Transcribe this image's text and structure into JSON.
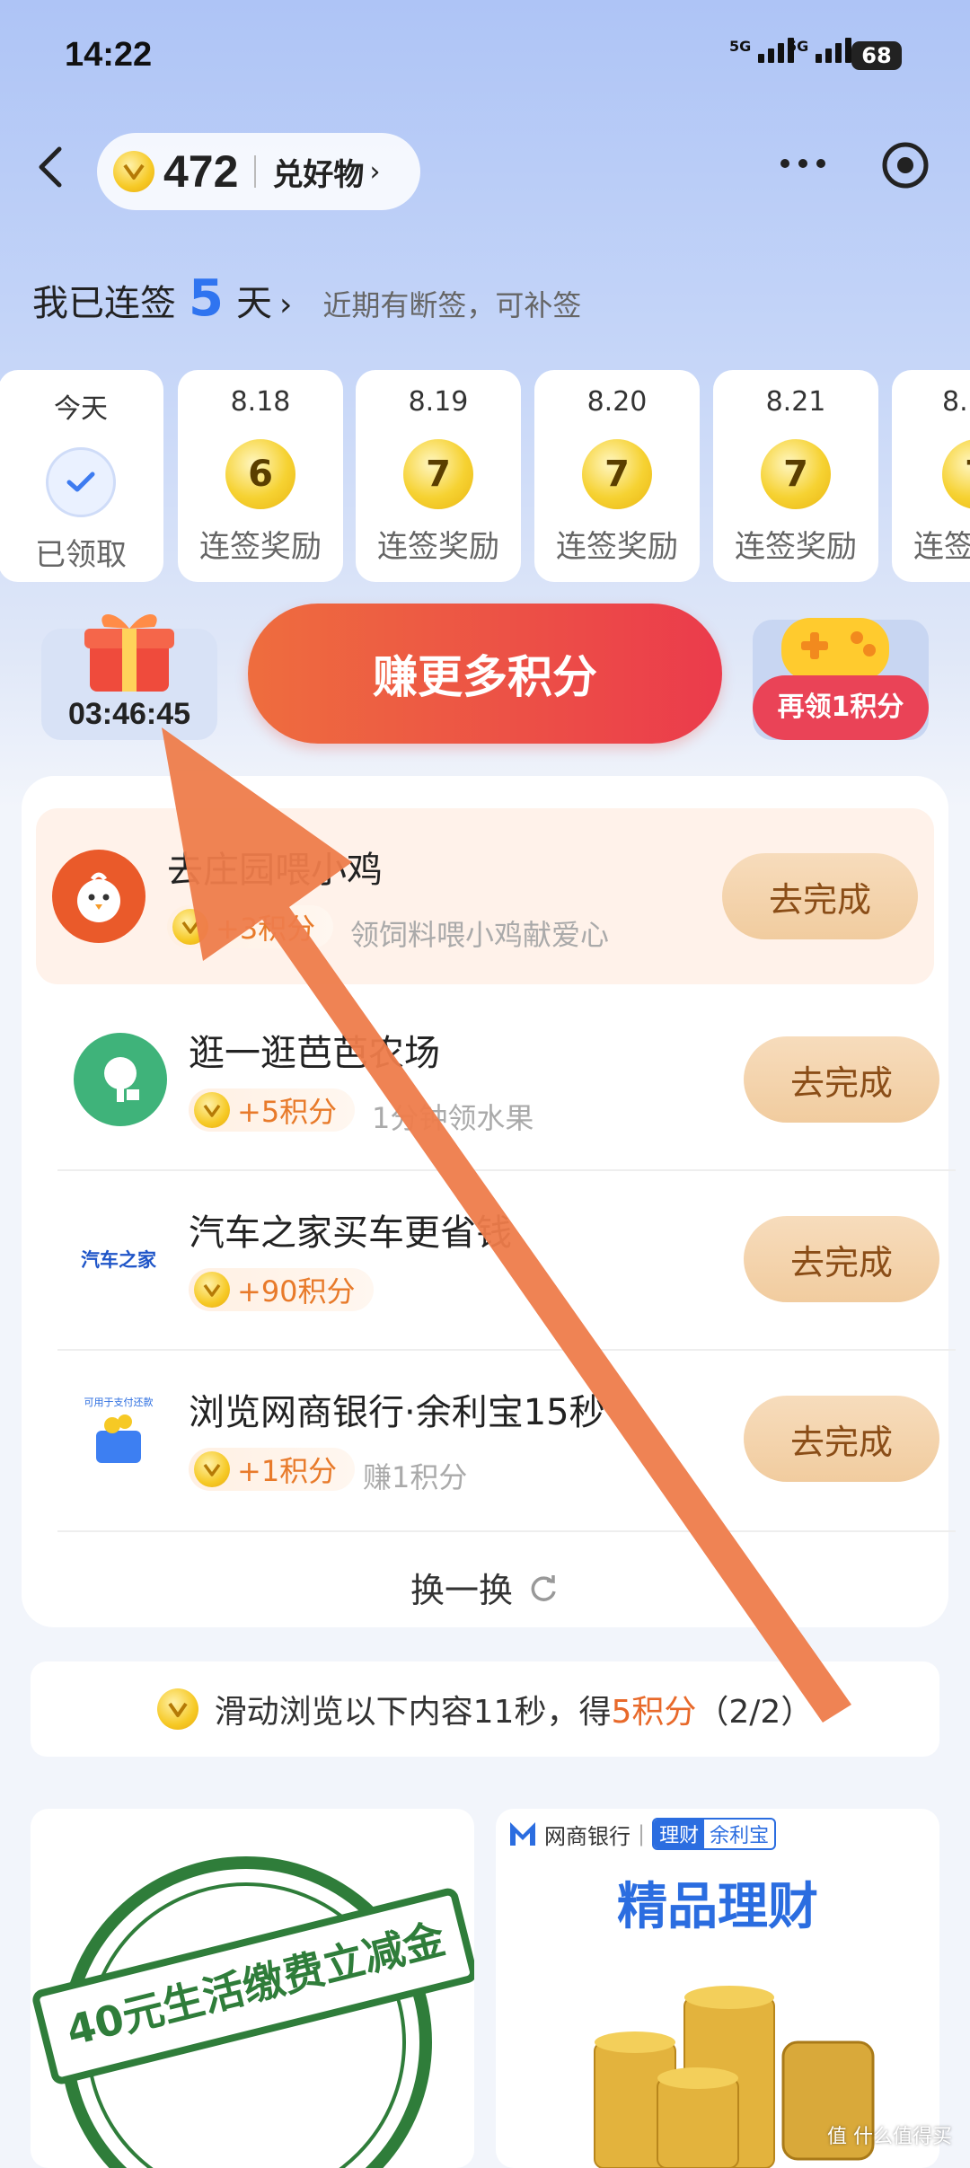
{
  "status_bar": {
    "time": "14:22",
    "network1": "5G",
    "network2": "5G",
    "battery": "68"
  },
  "header": {
    "points": "472",
    "exchange_link": "兑好物",
    "more_icon": "more-icon",
    "target_icon": "target-icon"
  },
  "streak": {
    "prefix": "我已连签",
    "days": "5",
    "suffix": "天",
    "chevron": "›",
    "note": "近期有断签，可补签"
  },
  "day_cards": [
    {
      "date": "今天",
      "badge": "",
      "label": "已领取"
    },
    {
      "date": "8.18",
      "badge": "6",
      "label": "连签奖励"
    },
    {
      "date": "8.19",
      "badge": "7",
      "label": "连签奖励"
    },
    {
      "date": "8.20",
      "badge": "7",
      "label": "连签奖励"
    },
    {
      "date": "8.21",
      "badge": "7",
      "label": "连签奖励"
    },
    {
      "date": "8.",
      "badge": "7",
      "label": "连签"
    }
  ],
  "actions": {
    "gift_timer": "03:46:45",
    "earn_more": "赚更多积分",
    "claim_again": "再领1积分"
  },
  "tasks": [
    {
      "title": "去庄园喂小鸡",
      "reward": "+3积分",
      "desc": "领饲料喂小鸡献爱心",
      "button": "去完成"
    },
    {
      "title": "逛一逛芭芭农场",
      "reward": "+5积分",
      "desc": "1分钟领水果",
      "button": "去完成"
    },
    {
      "title": "汽车之家买车更省钱",
      "reward": "+90积分",
      "desc": "",
      "button": "去完成"
    },
    {
      "title": "浏览网商银行·余利宝15秒",
      "reward": "+1积分",
      "desc": "赚1积分",
      "button": "去完成"
    }
  ],
  "task_icons": {
    "car_logo_text": "汽车之家",
    "bank_icon_text": "可用于支付还款"
  },
  "refresh": {
    "label": "换一换"
  },
  "scroll_task": {
    "text_a": "滑动浏览以下内容11秒，得",
    "highlight": "5积分",
    "text_b": "（2/2）"
  },
  "cards": {
    "left_stamp": "40元生活缴费立减金",
    "right_bank": "网商银行",
    "right_tag_a": "理财",
    "right_tag_b": "余利宝",
    "right_title": "精品理财"
  },
  "watermark": "值 什么值得买",
  "colors": {
    "accent_blue": "#2f74f0",
    "earn_gradient_start": "#ee6d3e",
    "earn_gradient_end": "#eb3b4c",
    "arrow": "#ee7c4b"
  }
}
